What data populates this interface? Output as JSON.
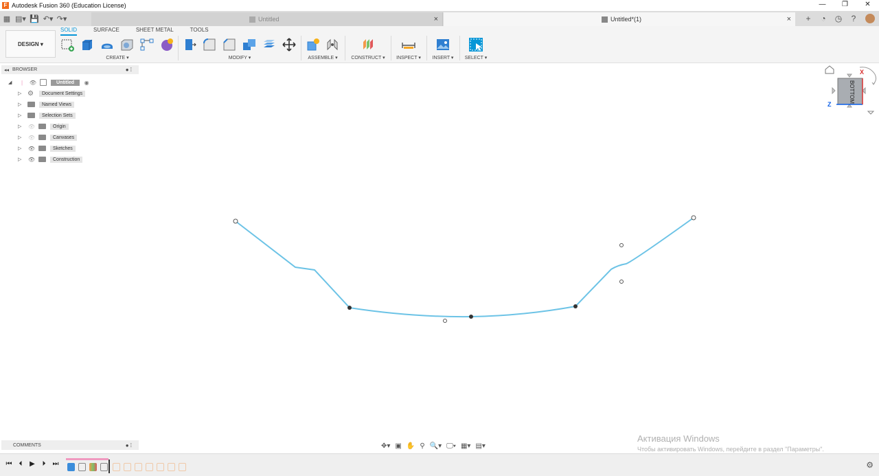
{
  "window": {
    "title": "Autodesk Fusion 360 (Education License)",
    "controls": [
      "minimize",
      "restore",
      "close"
    ]
  },
  "tabs": [
    {
      "label": "Untitled",
      "active": false
    },
    {
      "label": "Untitled*(1)",
      "active": true
    }
  ],
  "workspace": {
    "label": "DESIGN"
  },
  "ribbon": {
    "tabs": [
      "SOLID",
      "SURFACE",
      "SHEET METAL",
      "TOOLS"
    ],
    "active_tab": "SOLID",
    "groups": [
      "CREATE",
      "MODIFY",
      "ASSEMBLE",
      "CONSTRUCT",
      "INSPECT",
      "INSERT",
      "SELECT"
    ]
  },
  "browser": {
    "title": "BROWSER",
    "root": "Untitled",
    "items": [
      {
        "label": "Document Settings",
        "icon": "gear-icon",
        "eye": "none"
      },
      {
        "label": "Named Views",
        "icon": "folder-icon",
        "eye": "none"
      },
      {
        "label": "Selection Sets",
        "icon": "folder-icon",
        "eye": "none"
      },
      {
        "label": "Origin",
        "icon": "folder-icon",
        "eye": "hidden"
      },
      {
        "label": "Canvases",
        "icon": "folder-icon",
        "eye": "hidden"
      },
      {
        "label": "Sketches",
        "icon": "folder-icon",
        "eye": "visible"
      },
      {
        "label": "Construction",
        "icon": "folder-icon",
        "eye": "visible"
      }
    ]
  },
  "viewcube": {
    "face_label": "BOTTOM",
    "axis_x": "X",
    "axis_z": "Z"
  },
  "comments": {
    "label": "COMMENTS"
  },
  "watermark": {
    "line1": "Активация Windows",
    "line2": "Чтобы активировать Windows, перейдите в раздел \"Параметры\"."
  },
  "colors": {
    "accent": "#0696d7",
    "sketch_line": "#6cc3e6",
    "timeline_bar": "#f09ac0"
  }
}
